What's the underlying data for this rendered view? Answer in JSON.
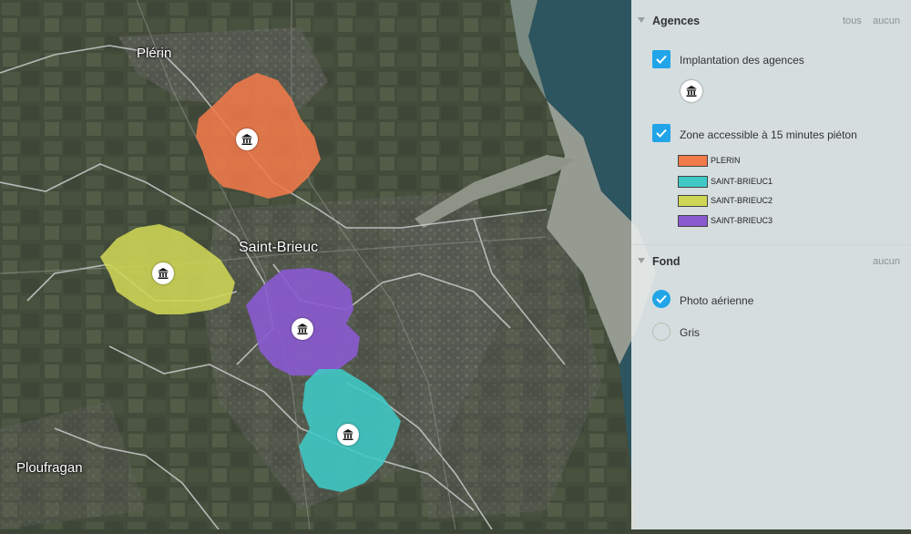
{
  "map": {
    "places": [
      "Plérin",
      "Saint-Brieuc",
      "Ploufragan"
    ],
    "colors": {
      "land": "#434b3b",
      "sea": "#2d5560",
      "beach": "#a9a89b",
      "boundary": "#c9cccc",
      "plerin": "#f07a4a",
      "saint_brieuc1": "#3fc9c6",
      "saint_brieuc2": "#cfd655",
      "saint_brieuc3": "#8a5ad0"
    }
  },
  "panel": {
    "agences": {
      "title": "Agences",
      "all_link": "tous",
      "none_link": "aucun",
      "layers": [
        {
          "label": "Implantation des agences",
          "checked": true,
          "legend_icon": "bank-icon"
        },
        {
          "label": "Zone accessible à 15 minutes piéton",
          "checked": true
        }
      ],
      "legend": [
        {
          "label": "PLERIN",
          "color": "#f07a4a"
        },
        {
          "label": "SAINT-BRIEUC1",
          "color": "#3fc9c6"
        },
        {
          "label": "SAINT-BRIEUC2",
          "color": "#cfd655"
        },
        {
          "label": "SAINT-BRIEUC3",
          "color": "#8a5ad0"
        }
      ]
    },
    "fond": {
      "title": "Fond",
      "none_link": "aucun",
      "options": [
        {
          "label": "Photo aérienne",
          "selected": true
        },
        {
          "label": "Gris",
          "selected": false
        }
      ]
    },
    "accent_color": "#21a5e8"
  }
}
